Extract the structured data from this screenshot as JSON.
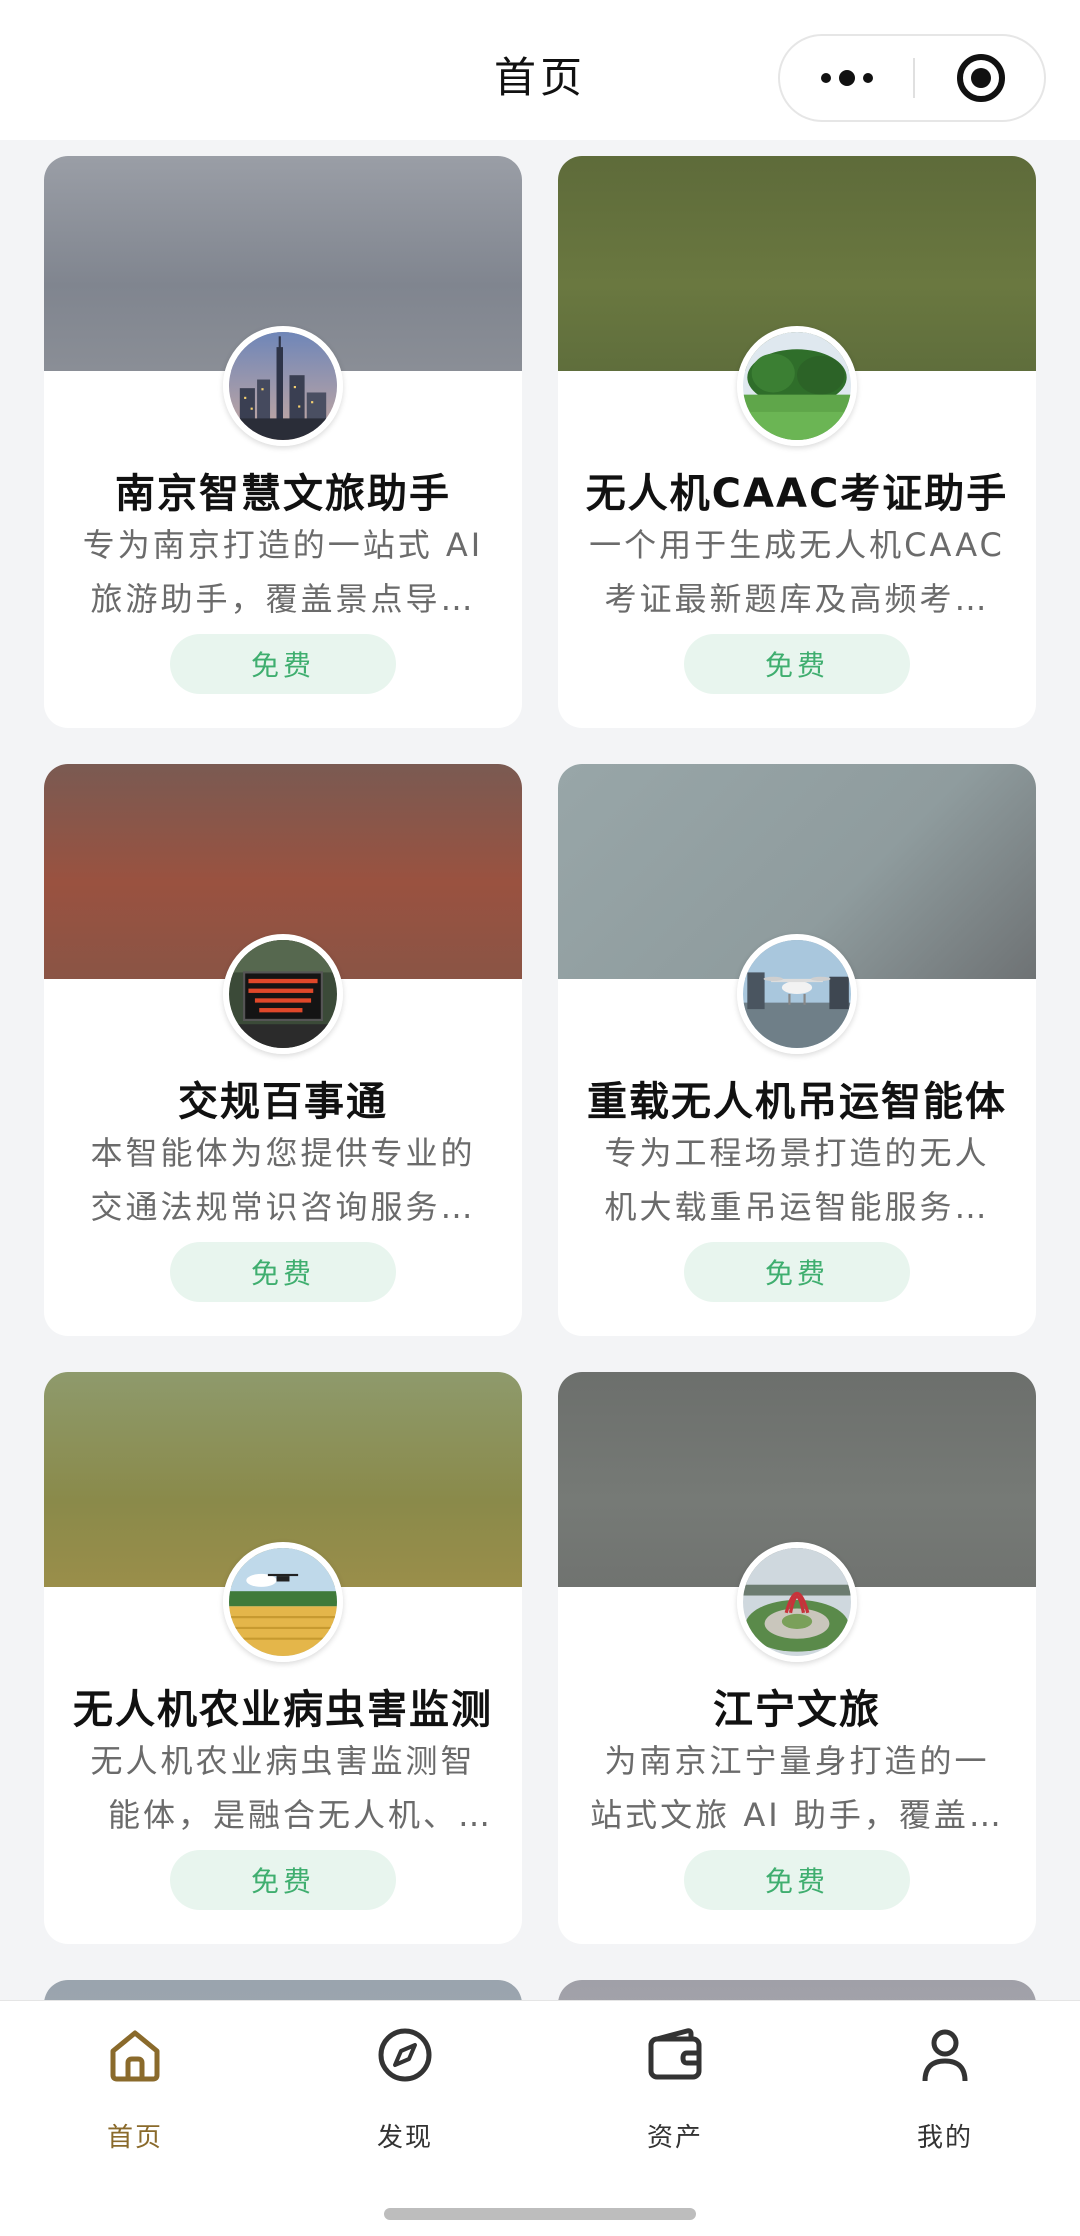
{
  "header": {
    "title": "首页",
    "more_icon": "more-dots-icon",
    "close_icon": "target-close-icon"
  },
  "cards": [
    {
      "name": "南京智慧文旅助手",
      "desc": "专为南京打造的一站式 AI 旅游助手，覆盖景点导…",
      "price": "免费",
      "banner_color": "#8a8e96",
      "avatar": "city-skyline"
    },
    {
      "name": "无人机CAAC考证助手",
      "desc": "一个用于生成无人机CAAC考证最新题库及高频考…",
      "price": "免费",
      "banner_color": "#5f6e3c",
      "avatar": "green-field"
    },
    {
      "name": "交规百事通",
      "desc": "本智能体为您提供专业的交通法规常识咨询服务…",
      "price": "免费",
      "banner_color": "#8a5445",
      "avatar": "led-sign"
    },
    {
      "name": "重载无人机吊运智能体",
      "desc": "专为工程场景打造的无人机大载重吊运智能服务…",
      "price": "免费",
      "banner_color": "#8f9a9c",
      "avatar": "drone"
    },
    {
      "name": "无人机农业病虫害监测",
      "desc": "无人机农业病虫害监测智能体，是融合无人机、多…",
      "price": "免费",
      "banner_color": "#8a8a4a",
      "avatar": "farm"
    },
    {
      "name": "江宁文旅",
      "desc": "为南京江宁量身打造的一站式文旅 AI 助手，覆盖…",
      "price": "免费",
      "banner_color": "#707370",
      "avatar": "garden"
    }
  ],
  "tabs": [
    {
      "label": "首页",
      "icon": "home-icon",
      "active": true
    },
    {
      "label": "发现",
      "icon": "compass-icon",
      "active": false
    },
    {
      "label": "资产",
      "icon": "wallet-icon",
      "active": false
    },
    {
      "label": "我的",
      "icon": "user-icon",
      "active": false
    }
  ],
  "colors": {
    "accent": "#8a6a2b",
    "badge_bg": "#e8f5ee",
    "badge_text": "#3fae6f"
  }
}
